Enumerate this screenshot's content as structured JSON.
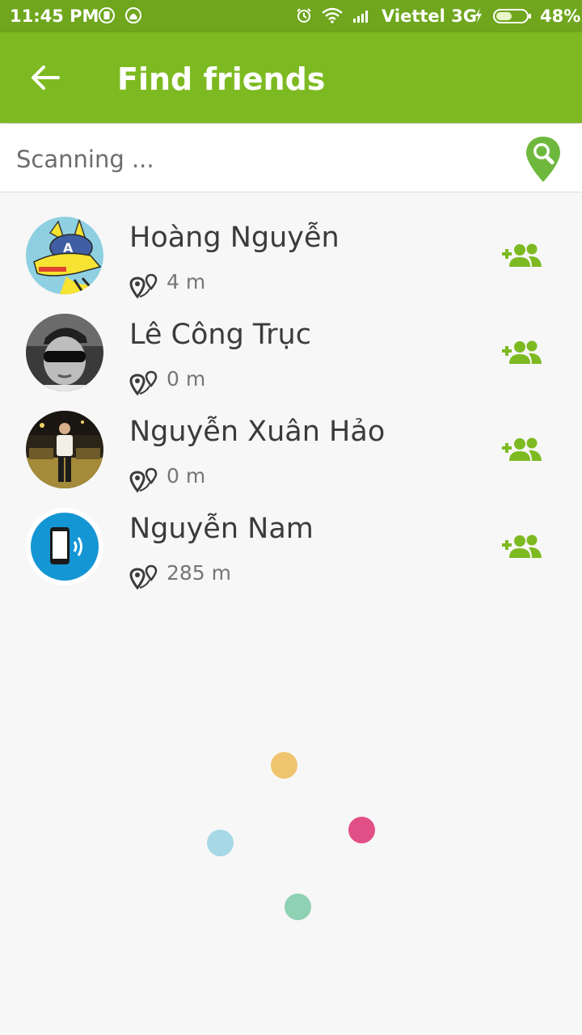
{
  "status_bar": {
    "time": "11:45 PM",
    "carrier": "Viettel 3G",
    "battery": "48%",
    "icons": [
      "sim-icon",
      "android-icon",
      "alarm-icon",
      "wifi-icon",
      "signal-icon",
      "charging-icon",
      "battery-icon"
    ]
  },
  "app_bar": {
    "back_icon": "arrow-left-icon",
    "title": "Find friends"
  },
  "scan": {
    "status_text": "Scanning ...",
    "icon": "location-search-icon"
  },
  "friends": [
    {
      "name": "Hoàng Nguyễn",
      "distance": "4 m",
      "avatar": "cartoon-character-avatar"
    },
    {
      "name": "Lê Công Trục",
      "distance": "0 m",
      "avatar": "person-sunglasses-avatar"
    },
    {
      "name": "Nguyễn Xuân Hảo",
      "distance": "0 m",
      "avatar": "person-night-photo-avatar"
    },
    {
      "name": "Nguyễn Nam",
      "distance": "285 m",
      "avatar": "phone-signal-avatar"
    }
  ],
  "loading_indicator": {
    "dot_colors": [
      "#efc46e",
      "#e24f86",
      "#a6d8e6",
      "#8fd1b3"
    ]
  },
  "colors": {
    "accent": "#7dba21",
    "status_bar": "#6fa61d"
  }
}
